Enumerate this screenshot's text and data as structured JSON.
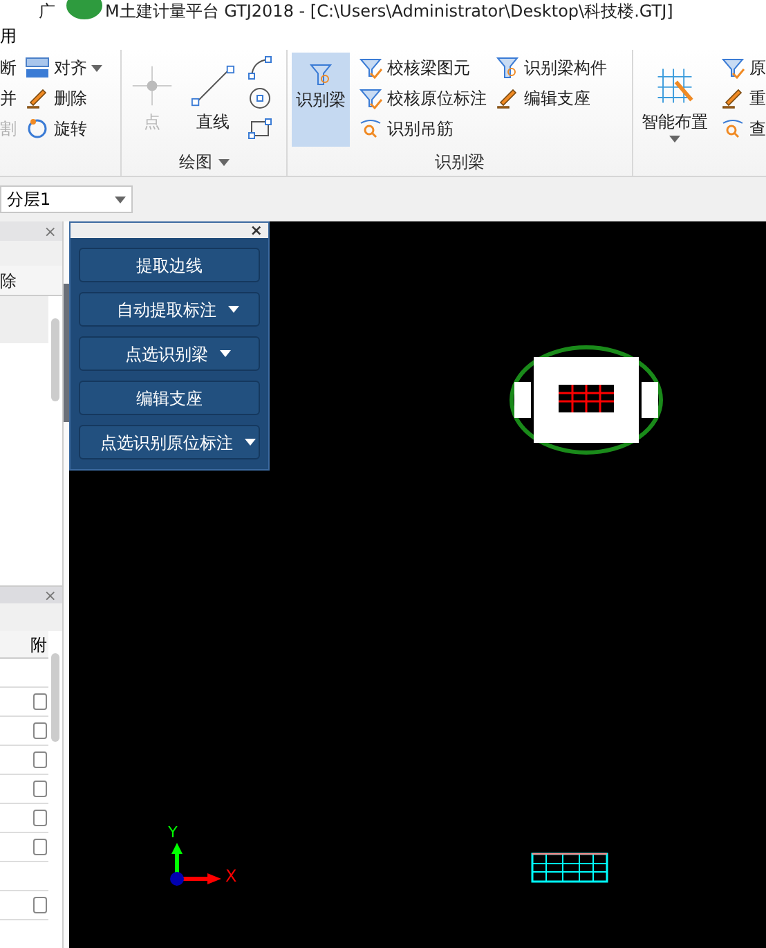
{
  "window": {
    "title_prefix": "广",
    "title": "M土建计量平台 GTJ2018 - [C:\\Users\\Administrator\\Desktop\\科技楼.GTJ]"
  },
  "menu": [
    "用"
  ],
  "ribbon": {
    "groups": [
      {
        "columns": [
          [
            {
              "kind": "text",
              "label": "断",
              "disabled": false,
              "dropdown": false
            },
            {
              "kind": "text",
              "label": "并",
              "disabled": false,
              "dropdown": false
            },
            {
              "kind": "text",
              "label": "割",
              "disabled": true,
              "dropdown": false
            }
          ],
          [
            {
              "kind": "small",
              "label": "对齐",
              "disabled": false,
              "dropdown": true
            },
            {
              "kind": "small",
              "label": "删除",
              "disabled": false,
              "dropdown": false
            },
            {
              "kind": "small",
              "label": "旋转",
              "disabled": false,
              "dropdown": false
            }
          ]
        ]
      },
      {
        "label": "绘图",
        "dropdown": true,
        "columns": [
          [
            {
              "kind": "large",
              "label": "点",
              "disabled": true,
              "selected": false,
              "dropdown": false
            }
          ],
          [
            {
              "kind": "large",
              "label": "直线",
              "disabled": false,
              "selected": false,
              "dropdown": false
            }
          ],
          [
            {
              "kind": "icon",
              "disabled": false
            },
            {
              "kind": "icon",
              "disabled": false
            },
            {
              "kind": "icon",
              "disabled": false
            }
          ]
        ]
      },
      {
        "label": "识别梁",
        "dropdown": false,
        "columns": [
          [
            {
              "kind": "large",
              "label": "识别梁",
              "disabled": false,
              "selected": true,
              "dropdown": false
            }
          ],
          [
            {
              "kind": "small",
              "label": "校核梁图元",
              "disabled": false,
              "dropdown": false
            },
            {
              "kind": "small",
              "label": "校核原位标注",
              "disabled": false,
              "dropdown": false
            },
            {
              "kind": "small",
              "label": "识别吊筋",
              "disabled": false,
              "dropdown": false
            }
          ],
          [
            {
              "kind": "small",
              "label": "识别梁构件",
              "disabled": false,
              "dropdown": false
            },
            {
              "kind": "small",
              "label": "编辑支座",
              "disabled": false,
              "dropdown": false
            }
          ]
        ]
      },
      {
        "columns": [
          [
            {
              "kind": "large",
              "label": "智能布置",
              "disabled": false,
              "selected": false,
              "dropdown": true
            }
          ],
          [
            {
              "kind": "small",
              "label": "原",
              "disabled": false
            },
            {
              "kind": "small",
              "label": "重",
              "disabled": false
            },
            {
              "kind": "small",
              "label": "查",
              "disabled": false
            }
          ]
        ]
      }
    ]
  },
  "layer_select": {
    "value": "分层1"
  },
  "left_panel": {
    "top": {
      "close": "×",
      "row": "除"
    },
    "bottom": {
      "close": "×",
      "column": "附",
      "rows": [
        {
          "kind": "check",
          "checked": false
        },
        {
          "kind": "check",
          "checked": false
        },
        {
          "kind": "check",
          "checked": false
        },
        {
          "kind": "check",
          "checked": false
        },
        {
          "kind": "check",
          "checked": false
        },
        {
          "kind": "check",
          "checked": false
        },
        {
          "kind": "blank"
        },
        {
          "kind": "check",
          "checked": false
        }
      ]
    }
  },
  "float_panel": {
    "close": "×",
    "buttons": [
      {
        "label": "提取边线",
        "dropdown": false
      },
      {
        "label": "自动提取标注",
        "dropdown": true
      },
      {
        "label": "点选识别梁",
        "dropdown": true
      },
      {
        "label": "编辑支座",
        "dropdown": false
      },
      {
        "label": "点选识别原位标注",
        "dropdown": true
      }
    ]
  },
  "canvas": {
    "axis": {
      "x": "X",
      "y": "Y"
    }
  }
}
